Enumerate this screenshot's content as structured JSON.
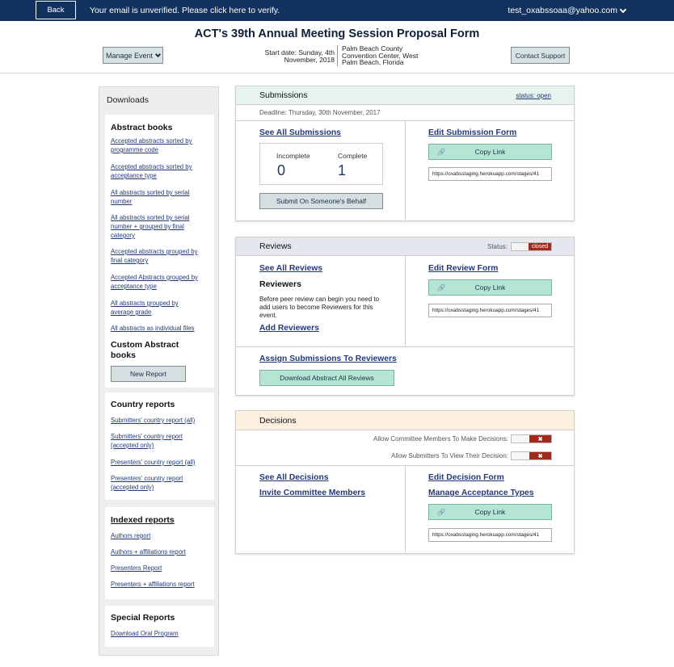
{
  "topbar": {
    "back_label": "Back",
    "unverified_text": "Your email is unverified. Please click here to verify.",
    "user_email": "test_oxabssoaa@yahoo.com"
  },
  "header": {
    "title": "ACT's 39th Annual Meeting Session Proposal Form",
    "manage_event_label": "Manage Event",
    "start_date_line1": "Start date: Sunday, 4th",
    "start_date_line2": "November, 2018",
    "venue_line1": "Palm Beach County",
    "venue_line2": "Convention Center, West",
    "venue_line3": "Palm Beach, Florida",
    "contact_support_label": "Contact Support"
  },
  "sidebar": {
    "title": "Downloads",
    "abstract_books": {
      "heading": "Abstract books",
      "links": [
        "Accepted abstracts sorted by programme code",
        "Accepted abstracts sorted by acceptance type",
        "All abstracts sorted by serial number",
        "All abstracts sorted by serial number + grouped by final category",
        "Accepted abstracts grouped by final category",
        "Accepted Abstracts grouped by acceptance type",
        "All abstracts grouped by average grade",
        "All abstracts as individual files"
      ],
      "custom_heading": "Custom Abstract books",
      "new_report_label": "New Report"
    },
    "country_reports": {
      "heading": "Country reports",
      "links": [
        "Submitters' country report (all)",
        "Submitters' country report (accepted only)",
        "Presenters' country report (all)",
        "Presenters' country report (accepted only)"
      ]
    },
    "indexed_reports": {
      "heading": "Indexed reports",
      "links": [
        "Authors report",
        "Authors + affiliations report",
        "Presenters Report",
        "Presenters + affiliations report"
      ]
    },
    "special_reports": {
      "heading": "Special Reports",
      "links": [
        "Download Oral Program"
      ]
    }
  },
  "submissions": {
    "title": "Submissions",
    "status_link": "status: open",
    "deadline": "Deadline: Thursday, 30th November, 2017",
    "see_all": "See All Submissions",
    "incomplete_label": "Incomplete",
    "incomplete_count": "0",
    "complete_label": "Complete",
    "complete_count": "1",
    "submit_behalf_label": "Submit On Someone's Behalf",
    "edit_form": "Edit Submission Form",
    "copy_link_label": "Copy Link",
    "url": "https://oxabsstaging.herokuapp.com/stages/41"
  },
  "reviews": {
    "title": "Reviews",
    "status_label": "Status:",
    "status_value": "closed",
    "see_all": "See All Reviews",
    "reviewers_heading": "Reviewers",
    "reviewers_text": "Before peer review can begin you need to add users to become Reviewers for this event.",
    "add_reviewers": "Add Reviewers",
    "edit_form": "Edit Review Form",
    "copy_link_label": "Copy Link",
    "url": "https://oxabsstaging.herokuapp.com/stages/41",
    "assign_link": "Assign Submissions To Reviewers",
    "download_all_label": "Download Abstract All Reviews"
  },
  "decisions": {
    "title": "Decisions",
    "allow_committee_label": "Allow Committee Members To Make Decisions:",
    "allow_submitters_label": "Allow Submitters To View Their Decision:",
    "toggle_off_glyph": "✖",
    "see_all": "See All Decisions",
    "invite_committee": "Invite Committee Members",
    "edit_form": "Edit Decision Form",
    "manage_acceptance": "Manage Acceptance Types",
    "copy_link_label": "Copy Link",
    "url": "https://oxabsstaging.herokuapp.com/stages/41"
  },
  "icons": {
    "link_icon": "🔗",
    "chevron": "chevron-down-icon"
  },
  "colors": {
    "topbar": "#12315e",
    "submissions_header": "#e6f3ee",
    "reviews_header": "#e4e8ee",
    "decisions_header": "#fdf0e0",
    "copy_button": "#b5e6d4",
    "toggle_off": "#a22a1c",
    "link": "#23397a"
  }
}
